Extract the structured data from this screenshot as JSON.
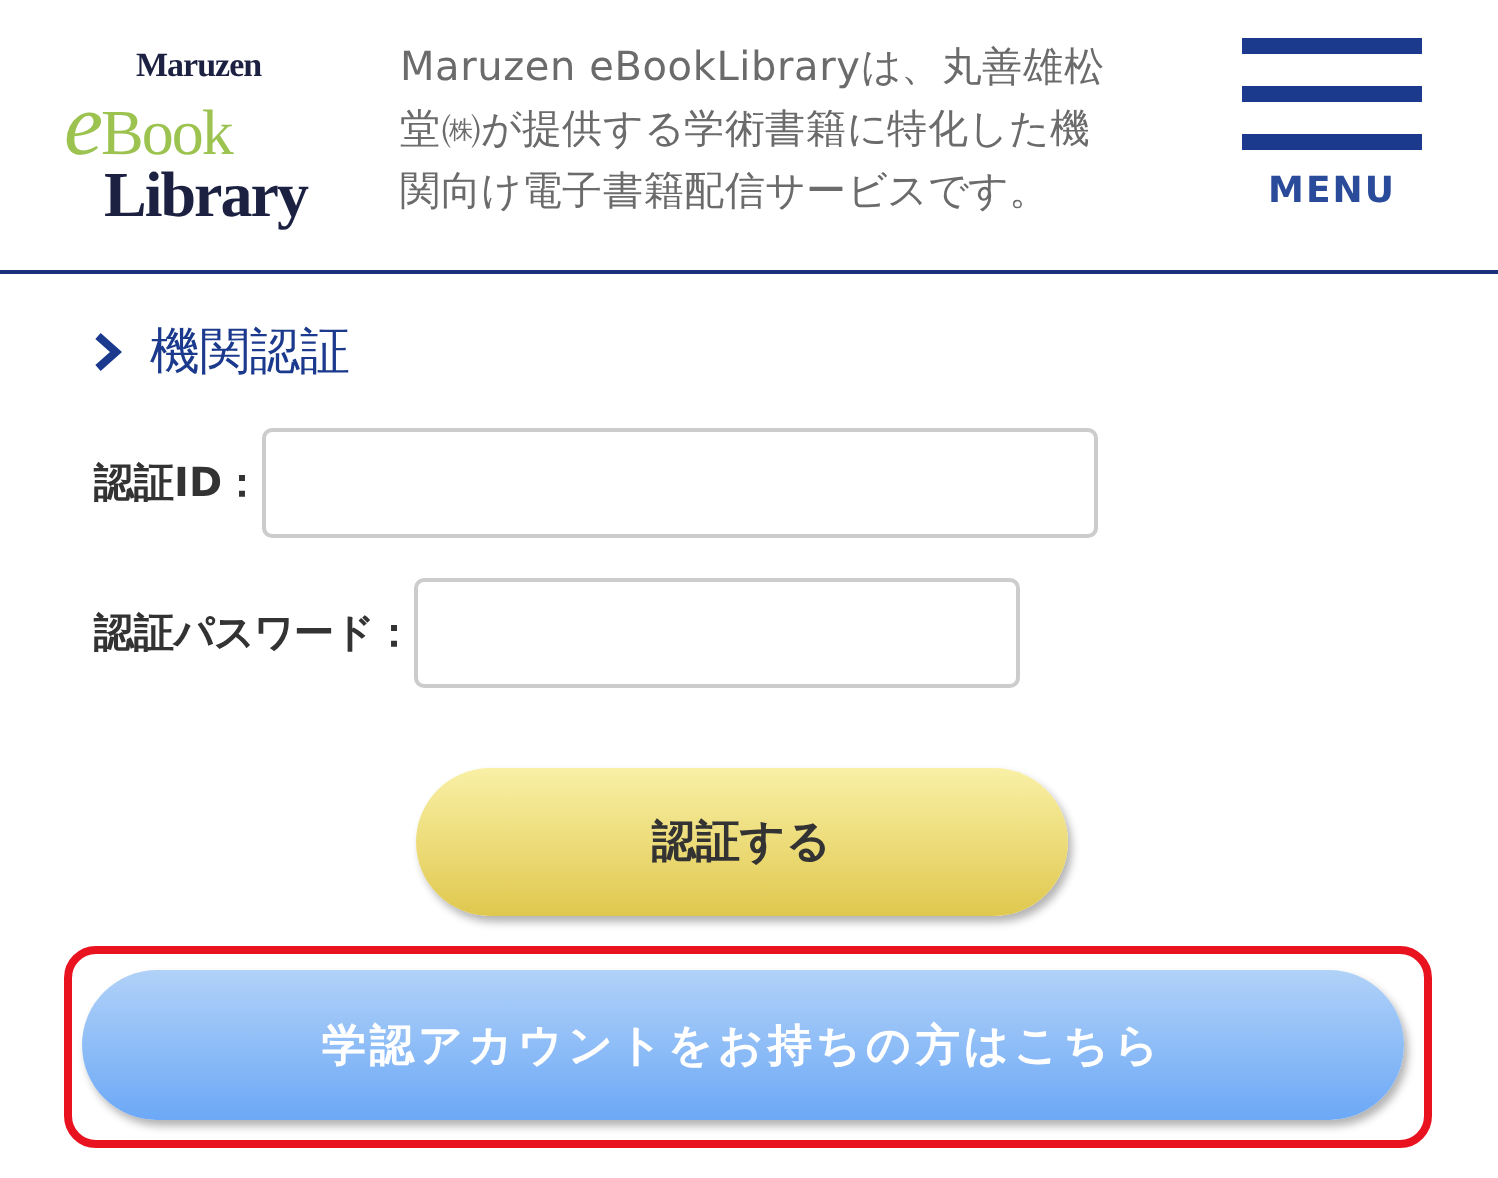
{
  "logo": {
    "top": "Maruzen",
    "middle": "eBook",
    "bottom": "Library"
  },
  "description": "Maruzen eBookLibraryは、丸善雄松堂㈱が提供する学術書籍に特化した機関向け電子書籍配信サービスです。",
  "menu": {
    "label": "MENU"
  },
  "section": {
    "title": "機関認証"
  },
  "fields": [
    {
      "label": "認証ID：",
      "kind": "text"
    },
    {
      "label": "認証パスワード：",
      "kind": "password"
    }
  ],
  "submit": {
    "label": "認証する"
  },
  "alt_button": {
    "label": "学認アカウントをお持ちの方はこちら",
    "highlighted": true
  }
}
